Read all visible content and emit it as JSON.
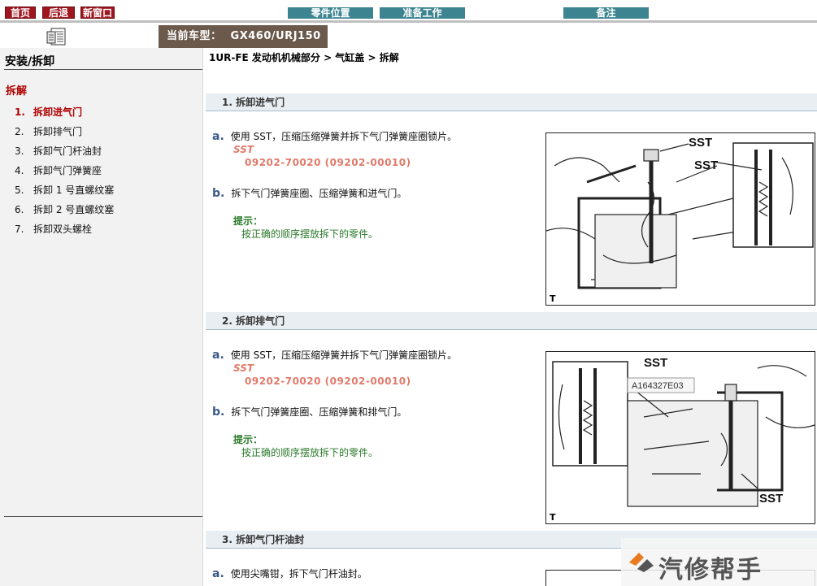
{
  "nav": {
    "home": "首页",
    "back": "后退",
    "new_window": "新窗口",
    "parts_location": "零件位置",
    "preparation": "准备工作",
    "notes": "备注"
  },
  "model": {
    "label": "当前车型：",
    "value": "GX460/URJ150"
  },
  "sidebar": {
    "title": "安装/拆卸",
    "section": "拆解",
    "items": [
      {
        "num": "1.",
        "label": "拆卸进气门"
      },
      {
        "num": "2.",
        "label": "拆卸排气门"
      },
      {
        "num": "3.",
        "label": "拆卸气门杆油封"
      },
      {
        "num": "4.",
        "label": "拆卸气门弹簧座"
      },
      {
        "num": "5.",
        "label": "拆卸 1 号直螺纹塞"
      },
      {
        "num": "6.",
        "label": "拆卸 2 号直螺纹塞"
      },
      {
        "num": "7.",
        "label": "拆卸双头螺栓"
      }
    ]
  },
  "breadcrumb": "1UR-FE 发动机机械部分 > 气缸盖 > 拆解",
  "sections": [
    {
      "title": "1. 拆卸进气门",
      "step_a": {
        "label": "a.",
        "text": "使用 SST，压缩压缩弹簧并拆下气门弹簧座圈锁片。"
      },
      "sst_label": "SST",
      "sst_number": "09202-70020 (09202-00010)",
      "step_b": {
        "label": "b.",
        "text": "拆下气门弹簧座圈、压缩弹簧和进气门。"
      },
      "hint_label": "提示：",
      "hint_text": "按正确的顺序摆放拆下的零件。",
      "figure": {
        "callouts": [
          "SST",
          "SST"
        ],
        "corner": "T"
      }
    },
    {
      "title": "2. 拆卸排气门",
      "step_a": {
        "label": "a.",
        "text": "使用 SST，压缩压缩弹簧并拆下气门弹簧座圈锁片。"
      },
      "sst_label": "SST",
      "sst_number": "09202-70020 (09202-00010)",
      "step_b": {
        "label": "b.",
        "text": "拆下气门弹簧座圈、压缩弹簧和排气门。"
      },
      "hint_label": "提示：",
      "hint_text": "按正确的顺序摆放拆下的零件。",
      "figure": {
        "callouts": [
          "SST",
          "SST"
        ],
        "tooltip": "A164327E03",
        "corner": "T"
      }
    },
    {
      "title": "3. 拆卸气门杆油封",
      "step_a": {
        "label": "a.",
        "text": "使用尖嘴钳，拆下气门杆油封。"
      }
    }
  ],
  "watermark": "汽修帮手"
}
